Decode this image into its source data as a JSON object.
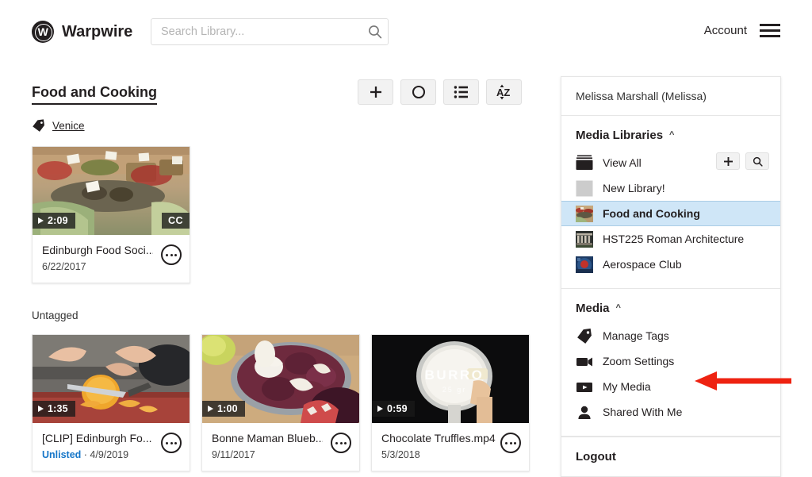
{
  "header": {
    "brand_initial": "W",
    "brand_name": "Warpwire",
    "search": {
      "value": "",
      "placeholder": "Search Library..."
    },
    "account_label": "Account"
  },
  "main": {
    "library_title": "Food and Cooking",
    "toolbar": [
      {
        "name": "add-button",
        "glyph": "+"
      },
      {
        "name": "record-button",
        "glyph": "circle"
      },
      {
        "name": "list-view-button",
        "glyph": "list"
      },
      {
        "name": "sort-button",
        "glyph": "AZ"
      }
    ],
    "groups": [
      {
        "label": "Venice",
        "is_tag": true,
        "items": [
          {
            "title": "Edinburgh Food Soci...",
            "date": "6/22/2017",
            "duration": "2:09",
            "cc": "CC",
            "status": "",
            "thumb": "market-produce"
          }
        ]
      },
      {
        "label": "Untagged",
        "is_tag": false,
        "items": [
          {
            "title": "[CLIP] Edinburgh Fo...",
            "date": "4/9/2019",
            "duration": "1:35",
            "cc": "",
            "status": "Unlisted",
            "thumb": "chopping-squash"
          },
          {
            "title": "Bonne Maman Blueb...",
            "date": "9/11/2017",
            "duration": "1:00",
            "cc": "",
            "status": "",
            "thumb": "blueberry-rolls"
          },
          {
            "title": "Chocolate Truffles.mp4",
            "date": "5/3/2018",
            "duration": "0:59",
            "cc": "",
            "status": "",
            "thumb": "burro-pan"
          }
        ]
      }
    ]
  },
  "panel": {
    "user": "Melissa Marshall (Melissa)",
    "sections": [
      {
        "title": "Media Libraries",
        "collapse_glyph": "^",
        "actions": [
          {
            "name": "add-library-button",
            "glyph": "+"
          },
          {
            "name": "search-libraries-button",
            "glyph": "search"
          }
        ],
        "items": [
          {
            "label": "View All",
            "icon": "stacked-books-icon",
            "active": false
          },
          {
            "label": "New Library!",
            "icon": "blank-thumbnail-icon",
            "active": false
          },
          {
            "label": "Food and Cooking",
            "icon": "food-thumbnail-icon",
            "active": true
          },
          {
            "label": "HST225 Roman Architecture",
            "icon": "architecture-thumbnail-icon",
            "active": false
          },
          {
            "label": "Aerospace Club",
            "icon": "aerospace-thumbnail-icon",
            "active": false
          }
        ]
      },
      {
        "title": "Media",
        "collapse_glyph": "^",
        "actions": [],
        "items": [
          {
            "label": "Manage Tags",
            "icon": "tag-icon",
            "active": false
          },
          {
            "label": "Zoom Settings",
            "icon": "video-camera-icon",
            "active": false
          },
          {
            "label": "My Media",
            "icon": "play-box-icon",
            "active": false
          },
          {
            "label": "Shared With Me",
            "icon": "person-icon",
            "active": false
          }
        ]
      }
    ],
    "logout_label": "Logout"
  },
  "annotation": {
    "arrow_color": "#ee2211",
    "points_to": "My Media"
  },
  "colors": {
    "accent_blue": "#1676c8",
    "active_row": "#cfe6f7",
    "text": "#231f20",
    "annotation_red": "#ee2211"
  }
}
